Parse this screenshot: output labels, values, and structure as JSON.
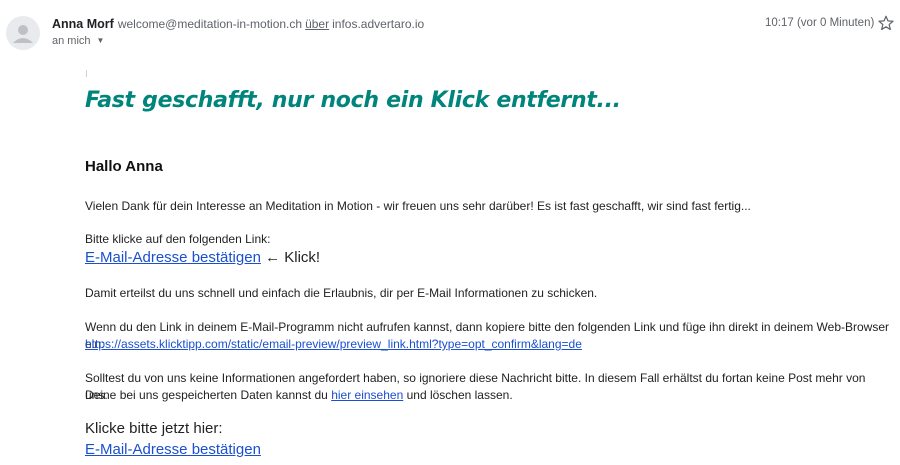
{
  "header": {
    "sender_name": "Anna Morf",
    "sender_email": "welcome@meditation-in-motion.ch",
    "via_label": "über",
    "via_domain": "infos.advertaro.io",
    "recipient": "an mich",
    "timestamp": "10:17 (vor 0 Minuten)"
  },
  "email": {
    "headline": "Fast geschafft, nur noch ein Klick entfernt...",
    "greeting": "Hallo Anna",
    "intro": "Vielen Dank für dein Interesse an Meditation in Motion - wir freuen uns sehr darüber! Es ist fast geschafft, wir sind fast fertig...",
    "click_prompt": "Bitte klicke auf den folgenden Link:",
    "confirm_link_label": "E-Mail-Adresse bestätigen",
    "arrow_text": "← Klick!",
    "permission_text": "Damit erteilst du uns schnell und einfach die Erlaubnis, dir per E-Mail Informationen zu schicken.",
    "fallback_text": "Wenn du den Link in deinem E-Mail-Programm nicht aufrufen kannst, dann kopiere bitte den folgenden Link und füge ihn direkt in deinem Web-Browser ein:",
    "fallback_url": "https://assets.klicktipp.com/static/email-preview/preview_link.html?type=opt_confirm&lang=de",
    "ignore_text_1": "Solltest du von uns keine Informationen angefordert haben, so ignoriere diese Nachricht bitte. In diesem Fall erhältst du fortan keine Post mehr von uns.",
    "ignore_text_2_prefix": "Deine bei uns gespeicherten Daten kannst du",
    "view_data_link": "hier einsehen",
    "ignore_text_2_suffix": "und löschen lassen.",
    "final_prompt": "Klicke bitte jetzt hier:",
    "final_link_label": "E-Mail-Adresse bestätigen"
  },
  "colors": {
    "headline": "#00857d",
    "link": "#1a4fd0",
    "muted": "#5f6368"
  },
  "icons": [
    "avatar-placeholder-icon",
    "chevron-down-icon",
    "star-icon"
  ]
}
